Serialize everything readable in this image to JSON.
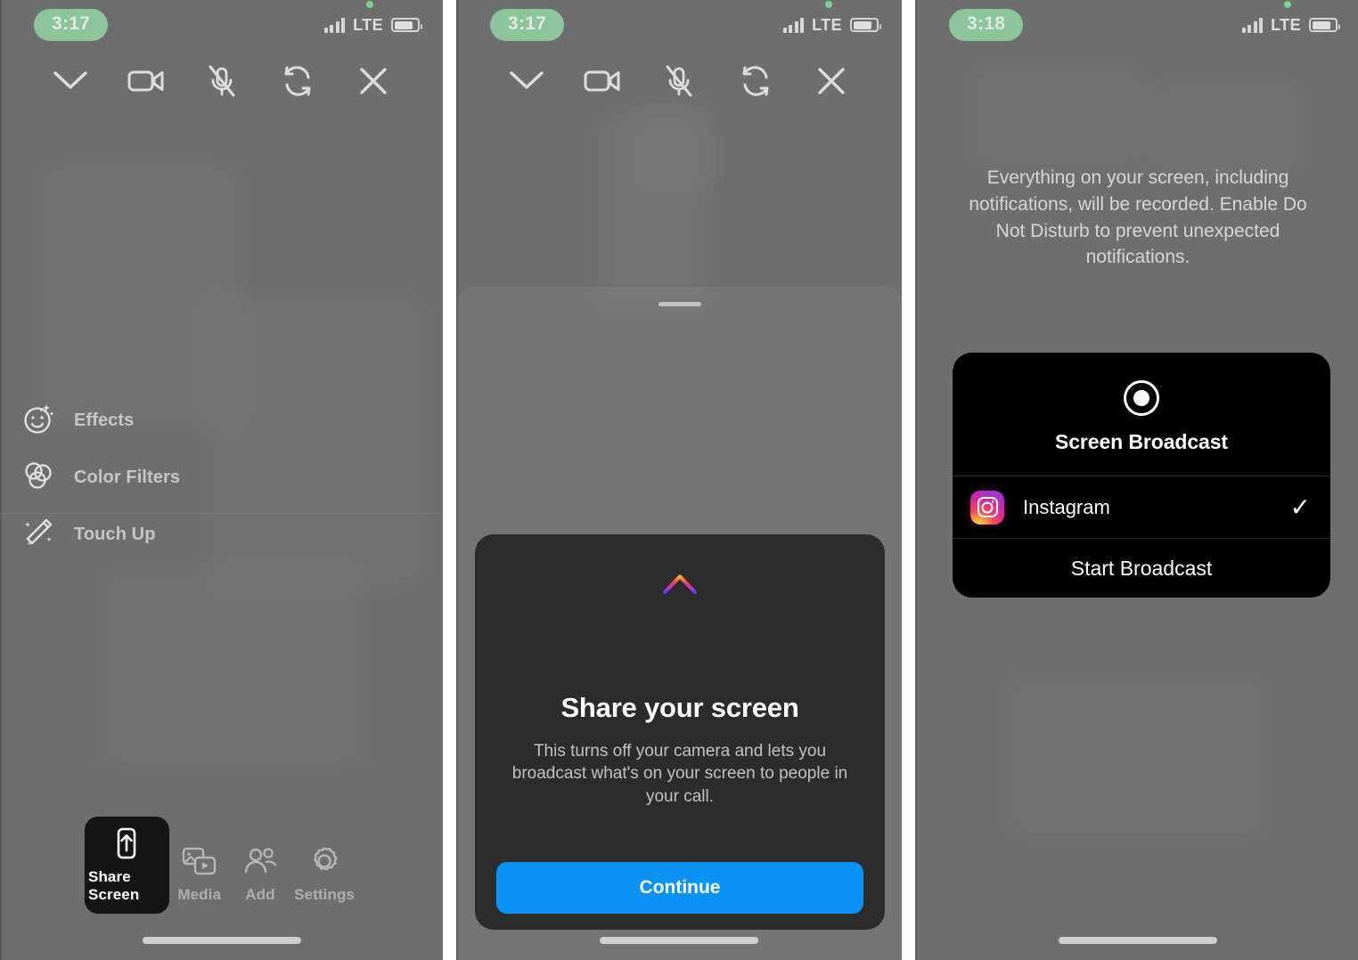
{
  "panels": {
    "left": {
      "status": {
        "time": "3:17",
        "carrier": "LTE"
      },
      "toolbar": [
        {
          "name": "minimize-chevron-icon",
          "label": "Minimize"
        },
        {
          "name": "camera-icon",
          "label": "Camera"
        },
        {
          "name": "microphone-muted-icon",
          "label": "Microphone muted"
        },
        {
          "name": "flip-camera-icon",
          "label": "Flip camera"
        },
        {
          "name": "end-call-close-icon",
          "label": "End call"
        }
      ],
      "effects": [
        {
          "label": "Effects",
          "icon": "smiley-sparkles-icon"
        },
        {
          "label": "Color Filters",
          "icon": "color-filters-icon"
        },
        {
          "label": "Touch Up",
          "icon": "magic-wand-icon"
        }
      ],
      "dock": [
        {
          "label": "Share Screen",
          "icon": "share-screen-icon",
          "active": true
        },
        {
          "label": "Media",
          "icon": "media-icon",
          "active": false
        },
        {
          "label": "Add",
          "icon": "add-people-icon",
          "active": false
        },
        {
          "label": "Settings",
          "icon": "gear-icon",
          "active": false
        }
      ]
    },
    "middle": {
      "status": {
        "time": "3:17",
        "carrier": "LTE"
      },
      "card": {
        "title": "Share your screen",
        "description": "This turns off your camera and lets you broadcast what's on your screen to people in your call.",
        "button_label": "Continue",
        "arrow_icon": "up-arrow-gradient-icon"
      }
    },
    "right": {
      "status": {
        "time": "3:18",
        "carrier": "LTE"
      },
      "notice": "Everything on your screen, including notifications, will be recorded. Enable Do Not Disturb to prevent unexpected notifications.",
      "dialog": {
        "title": "Screen Broadcast",
        "record_icon": "record-circle-icon",
        "app": {
          "name": "Instagram",
          "icon": "instagram-icon",
          "selected": true,
          "check_glyph": "✓"
        },
        "start_label": "Start Broadcast"
      }
    }
  },
  "colors": {
    "panel_bg": "#6e6e6e",
    "time_pill": "#8cc49b",
    "card_bg": "#2c2c2c",
    "accent_blue": "#0a93f5",
    "dialog_bg": "#000000",
    "dock_active_bg": "#151515"
  }
}
